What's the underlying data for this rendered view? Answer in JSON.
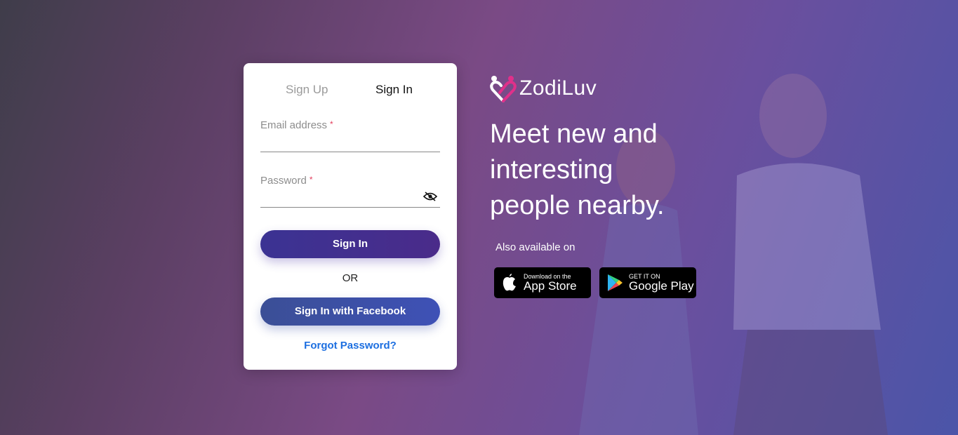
{
  "brand": {
    "name": "ZodiLuv"
  },
  "tabs": {
    "sign_up": "Sign Up",
    "sign_in": "Sign In"
  },
  "form": {
    "email_label": "Email address",
    "password_label": "Password",
    "required_marker": "*",
    "email_value": "",
    "password_value": ""
  },
  "buttons": {
    "sign_in": "Sign In",
    "or": "OR",
    "facebook": "Sign In with Facebook",
    "forgot": "Forgot Password?"
  },
  "hero": {
    "headline_line1": "Meet new and",
    "headline_line2": "interesting",
    "headline_line3": "people nearby.",
    "also_available": "Also available on"
  },
  "stores": {
    "apple_small": "Download on the",
    "apple_big": "App Store",
    "google_small": "GET IT ON",
    "google_big": "Google Play"
  },
  "icons": {
    "eye": "eye-slash-icon",
    "apple": "apple-icon",
    "google_play": "google-play-icon",
    "logo": "zodiluv-logo-icon"
  }
}
